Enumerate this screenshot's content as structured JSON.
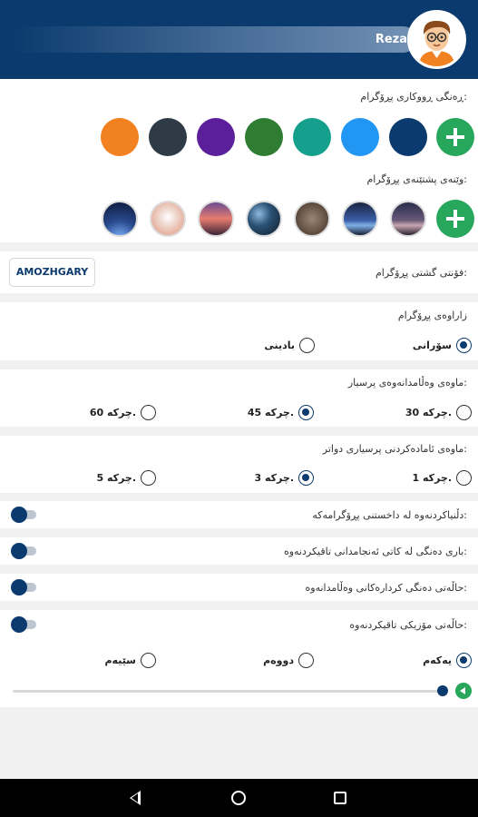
{
  "header": {
    "user_name": "Reza",
    "avatar_icon": "boy-glasses-avatar-icon"
  },
  "app_color": {
    "label": "ڕەنگی ڕووکاری پڕۆگرام:",
    "colors": [
      "#f28121",
      "#2e3a45",
      "#5b1f9c",
      "#2e7d32",
      "#14a08c",
      "#2196f3",
      "#0b3a6e"
    ],
    "add_icon": "plus-icon"
  },
  "app_background": {
    "label": "وێنەی پشتێنەی پڕۆگرام:",
    "thumb_icons": [
      "night-sky-icon",
      "dandelion-icon",
      "sunset-icon",
      "starry-night-icon",
      "stone-icon",
      "blue-horizon-icon",
      "dusk-icon"
    ],
    "add_icon": "plus-icon"
  },
  "font": {
    "label": "فۆنتی گشتی پڕۆگرام:",
    "button": "AMOZHGARY"
  },
  "dialect": {
    "label": "زاراوەی پڕۆگرام",
    "options": [
      "سۆرانی",
      "بادینی"
    ],
    "selected": 0
  },
  "question_time": {
    "label": "ماوەی وەڵامدانەوەی پرسیار:",
    "options": [
      "30 چرکە.",
      "45 چرکە.",
      "60 چرکە."
    ],
    "selected": 1
  },
  "next_question_time": {
    "label": "ماوەی ئامادەکردنی پرسیاری دواتر:",
    "options": [
      "1 چرکە.",
      "3 چرکە.",
      "5 چرکە."
    ],
    "selected": 1
  },
  "toggles": [
    {
      "label": "دڵنیاکردنەوە لە داخستنی پڕۆگرامەکە:"
    },
    {
      "label": "باری دەنگی لە کاتی ئەنجامدانی تاقیکردنەوە:"
    },
    {
      "label": "حاڵەتی دەنگی کردارەکانی وەڵامدانەوە:"
    },
    {
      "label": "حاڵەتی مۆزیکی تاقیکردنەوە:"
    }
  ],
  "music": {
    "options": [
      "یەکەم",
      "دووەم",
      "سێیەم"
    ],
    "selected": 0,
    "volume_fraction": 0.96,
    "play_icon": "play-icon"
  },
  "nav": {
    "back_icon": "back-icon",
    "home_icon": "home-icon",
    "recent_icon": "recent-apps-icon"
  }
}
